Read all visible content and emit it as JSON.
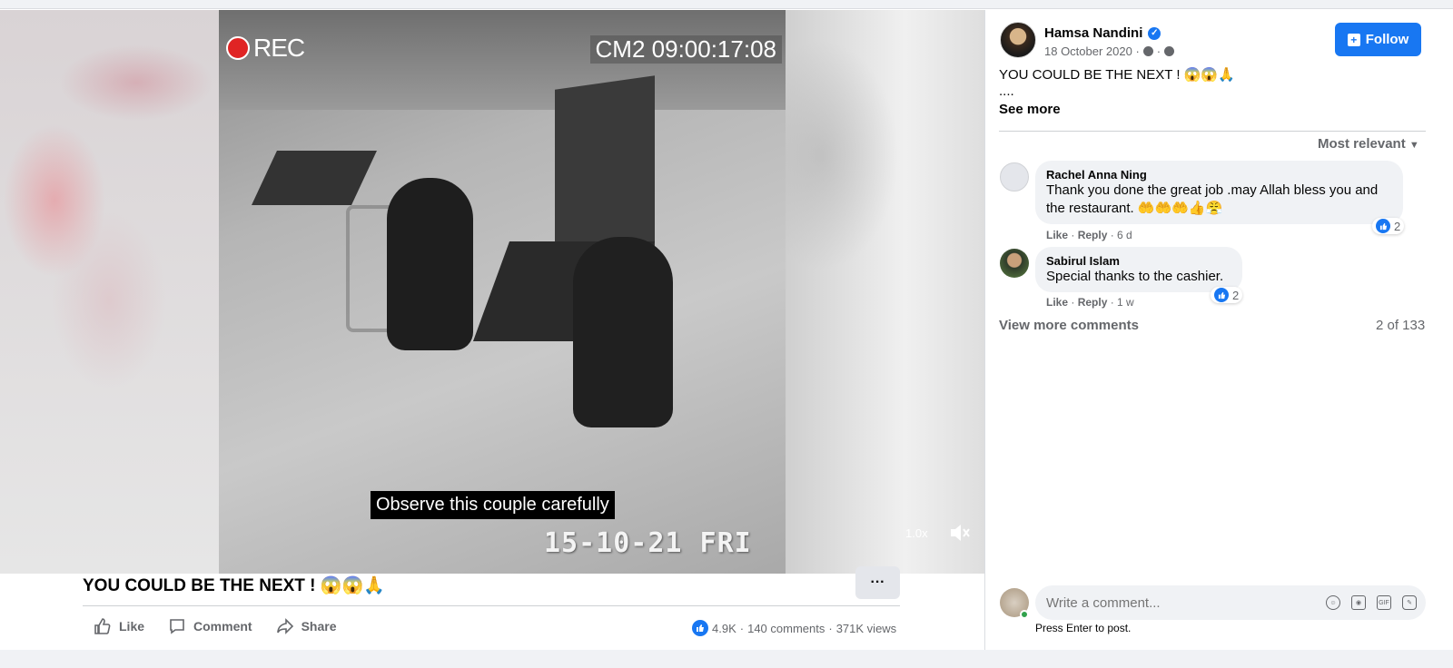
{
  "video": {
    "rec_label": "REC",
    "camera_stamp": "CM2 09:00:17:08",
    "subtitle": "Observe this couple carefully",
    "date_stamp": "15-10-21 FRI",
    "speed": "1.0x",
    "mute_icon": "speaker-muted-icon"
  },
  "post": {
    "title": "YOU COULD BE THE NEXT ! 😱😱🙏",
    "more_label": "···",
    "actions": {
      "like": "Like",
      "comment": "Comment",
      "share": "Share"
    },
    "stats": {
      "reactions": "4.9K",
      "comments": "140 comments",
      "views": "371K views"
    }
  },
  "panel": {
    "author": "Hamsa Nandini",
    "date": "18 October 2020 ·",
    "follow_label": "Follow",
    "caption": "YOU COULD BE THE NEXT ! 😱😱🙏",
    "dots": "....",
    "see_more": "See more",
    "sort": "Most relevant",
    "comments": [
      {
        "name": "Rachel Anna Ning",
        "text": "Thank you done the great job .may Allah bless you and the restaurant. 🤲🤲🤲👍😤",
        "like": "Like",
        "reply": "Reply",
        "age": "6 d",
        "reactions": "2"
      },
      {
        "name": "Sabirul Islam",
        "text": "Special thanks to the cashier.",
        "like": "Like",
        "reply": "Reply",
        "age": "1 w",
        "reactions": "2"
      }
    ],
    "view_more": "View more comments",
    "count": "2 of 133",
    "input_placeholder": "Write a comment...",
    "hint": "Press Enter to post."
  },
  "colors": {
    "accent": "#1877f2",
    "muted": "#65676b",
    "bubble": "#f0f2f5"
  }
}
